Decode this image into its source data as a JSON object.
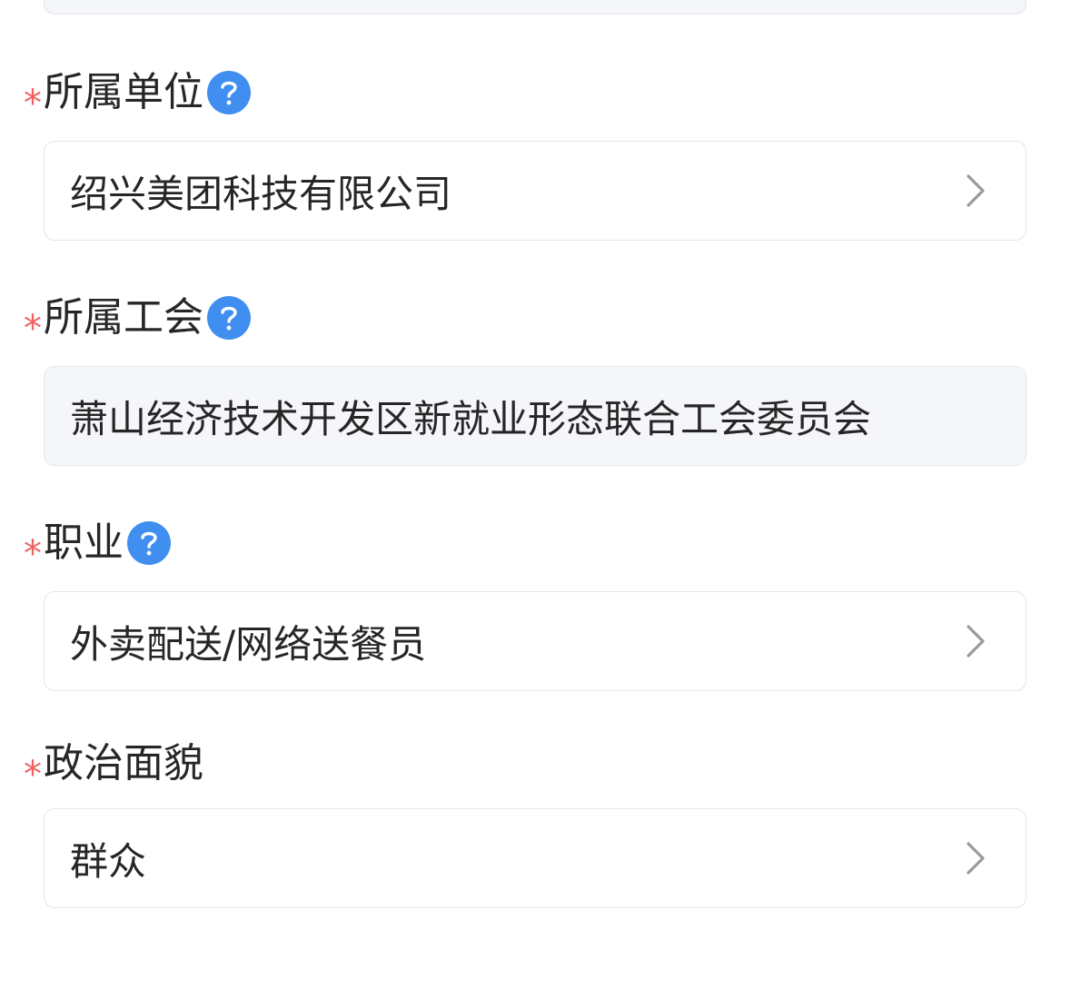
{
  "required_mark": "*",
  "colors": {
    "required": "#f06262",
    "help_icon": "#3f8ef0",
    "field_border": "#e3e6ec",
    "readonly_bg": "#f5f6fa"
  },
  "fields": {
    "unit": {
      "label": "所属单位",
      "value": "绍兴美团科技有限公司",
      "icon": "question-circle-icon",
      "control": "chevron-right-icon"
    },
    "union": {
      "label": "所属工会",
      "value": "萧山经济技术开发区新就业形态联合工会委员会",
      "icon": "question-circle-icon"
    },
    "occupation": {
      "label": "职业",
      "value": "外卖配送/网络送餐员",
      "icon": "question-circle-icon",
      "control": "chevron-right-icon"
    },
    "political_status": {
      "label": "政治面貌",
      "value": "群众",
      "control": "chevron-right-icon"
    }
  }
}
